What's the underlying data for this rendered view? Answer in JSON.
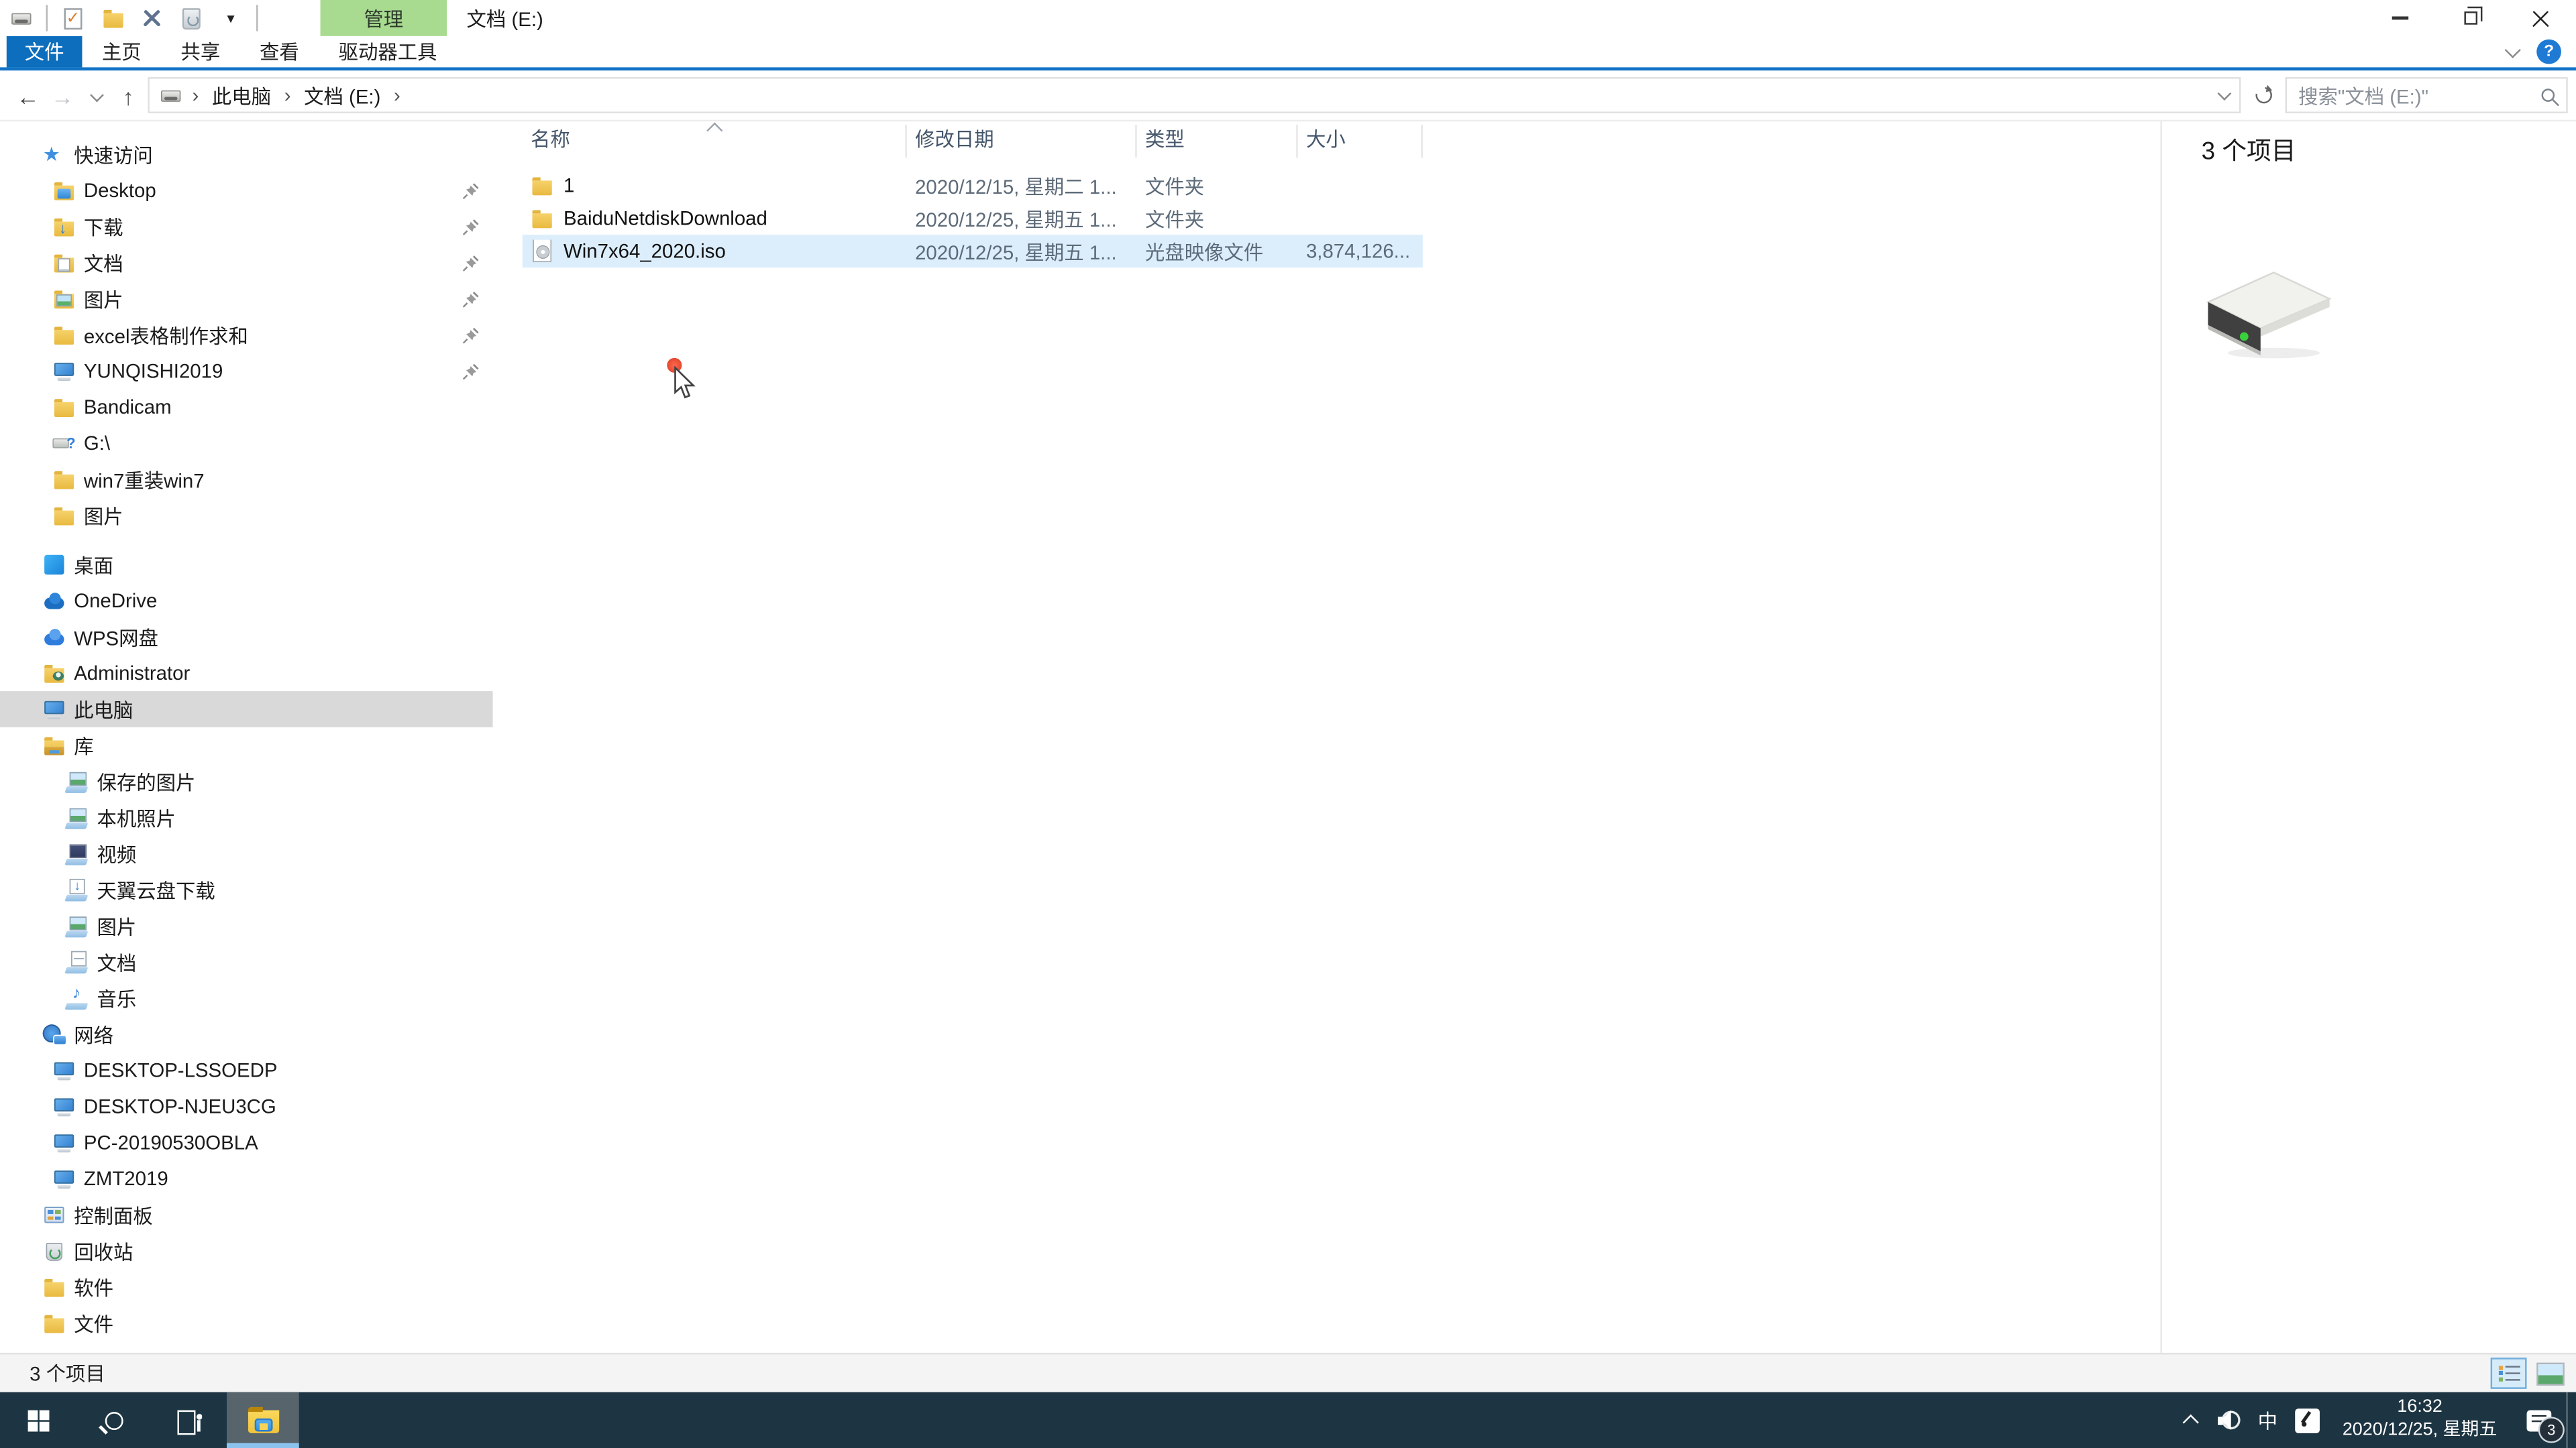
{
  "icons": {
    "qat_caret": "▾",
    "back": "←",
    "forward": "→",
    "up": "↑",
    "breadcrumb_sep": "›",
    "help": "?"
  },
  "titlebar": {
    "contextual_group": "管理",
    "title": "文档 (E:)"
  },
  "ribbon": {
    "file_tab": "文件",
    "tabs": [
      "主页",
      "共享",
      "查看",
      "驱动器工具"
    ]
  },
  "navbar": {
    "breadcrumb": [
      "此电脑",
      "文档 (E:)"
    ],
    "search_placeholder": "搜索\"文档 (E:)\""
  },
  "sidebar": {
    "items": [
      {
        "key": "quick-access",
        "label": "快速访问",
        "icon": "star",
        "depth": 0
      },
      {
        "key": "desktop-quick",
        "label": "Desktop",
        "icon": "desktop-folder",
        "depth": 1,
        "pinned": true
      },
      {
        "key": "downloads",
        "label": "下载",
        "icon": "download-folder",
        "depth": 1,
        "pinned": true
      },
      {
        "key": "documents",
        "label": "文档",
        "icon": "documents-folder",
        "depth": 1,
        "pinned": true
      },
      {
        "key": "pictures",
        "label": "图片",
        "icon": "pictures-folder",
        "depth": 1,
        "pinned": true
      },
      {
        "key": "excel-folder",
        "label": "excel表格制作求和",
        "icon": "folder",
        "depth": 1,
        "pinned": true
      },
      {
        "key": "yunqishi2019",
        "label": "YUNQISHI2019",
        "icon": "computer",
        "depth": 1,
        "pinned": true
      },
      {
        "key": "bandicam",
        "label": "Bandicam",
        "icon": "folder",
        "depth": 1
      },
      {
        "key": "g-drive",
        "label": "G:\\",
        "icon": "usb-drive",
        "depth": 1
      },
      {
        "key": "win7-reinstall",
        "label": "win7重装win7",
        "icon": "folder",
        "depth": 1
      },
      {
        "key": "pictures-2",
        "label": "图片",
        "icon": "folder",
        "depth": 1
      },
      {
        "key": "desktop",
        "label": "桌面",
        "icon": "desktop",
        "depth": 0,
        "gap": true
      },
      {
        "key": "onedrive",
        "label": "OneDrive",
        "icon": "cloud",
        "depth": 0
      },
      {
        "key": "wps-cloud",
        "label": "WPS网盘",
        "icon": "cloud2",
        "depth": 0
      },
      {
        "key": "administrator",
        "label": "Administrator",
        "icon": "user-folder",
        "depth": 0
      },
      {
        "key": "this-pc",
        "label": "此电脑",
        "icon": "computer",
        "depth": 0,
        "selected": true
      },
      {
        "key": "libraries",
        "label": "库",
        "icon": "library",
        "depth": 0
      },
      {
        "key": "saved-pictures",
        "label": "保存的图片",
        "icon": "pictures-library",
        "depth": 2
      },
      {
        "key": "local-photos",
        "label": "本机照片",
        "icon": "pictures-library",
        "depth": 2
      },
      {
        "key": "videos",
        "label": "视频",
        "icon": "videos-library",
        "depth": 2
      },
      {
        "key": "tianyi-cloud-download",
        "label": "天翼云盘下载",
        "icon": "download-library",
        "depth": 2
      },
      {
        "key": "pictures-library",
        "label": "图片",
        "icon": "pictures-library",
        "depth": 2
      },
      {
        "key": "documents-library",
        "label": "文档",
        "icon": "documents-library",
        "depth": 2
      },
      {
        "key": "music",
        "label": "音乐",
        "icon": "music-library",
        "depth": 2
      },
      {
        "key": "network",
        "label": "网络",
        "icon": "network",
        "depth": 0
      },
      {
        "key": "desktop-lssoedp",
        "label": "DESKTOP-LSSOEDP",
        "icon": "network-computer",
        "depth": 1
      },
      {
        "key": "desktop-njeu3cg",
        "label": "DESKTOP-NJEU3CG",
        "icon": "network-computer",
        "depth": 1
      },
      {
        "key": "pc-20190530obla",
        "label": "PC-20190530OBLA",
        "icon": "network-computer",
        "depth": 1
      },
      {
        "key": "zmt2019",
        "label": "ZMT2019",
        "icon": "network-computer",
        "depth": 1
      },
      {
        "key": "control-panel",
        "label": "控制面板",
        "icon": "control-panel",
        "depth": 0
      },
      {
        "key": "recycle-bin",
        "label": "回收站",
        "icon": "recycle-bin",
        "depth": 0
      },
      {
        "key": "software",
        "label": "软件",
        "icon": "folder",
        "depth": 0
      },
      {
        "key": "files",
        "label": "文件",
        "icon": "folder",
        "depth": 0
      }
    ]
  },
  "filelist": {
    "columns": [
      "名称",
      "修改日期",
      "类型",
      "大小"
    ],
    "rows": [
      {
        "name": "1",
        "icon": "folder",
        "modified": "2020/12/15, 星期二 1...",
        "type": "文件夹",
        "size": ""
      },
      {
        "name": "BaiduNetdiskDownload",
        "icon": "folder",
        "modified": "2020/12/25, 星期五 1...",
        "type": "文件夹",
        "size": ""
      },
      {
        "name": "Win7x64_2020.iso",
        "icon": "disc-image",
        "modified": "2020/12/25, 星期五 1...",
        "type": "光盘映像文件",
        "size": "3,874,126...",
        "selected": true
      }
    ]
  },
  "preview": {
    "item_count": "3 个项目"
  },
  "statusbar": {
    "item_count": "3 个项目"
  },
  "taskbar": {
    "ime": "中",
    "time": "16:32",
    "date": "2020/12/25, 星期五",
    "notification_count": "3"
  }
}
